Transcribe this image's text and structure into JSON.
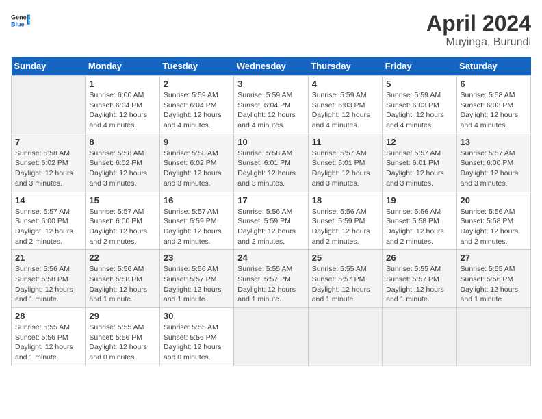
{
  "header": {
    "logo_general": "General",
    "logo_blue": "Blue",
    "title": "April 2024",
    "subtitle": "Muyinga, Burundi"
  },
  "calendar": {
    "days_of_week": [
      "Sunday",
      "Monday",
      "Tuesday",
      "Wednesday",
      "Thursday",
      "Friday",
      "Saturday"
    ],
    "weeks": [
      [
        {
          "day": "",
          "info": ""
        },
        {
          "day": "1",
          "info": "Sunrise: 6:00 AM\nSunset: 6:04 PM\nDaylight: 12 hours\nand 4 minutes."
        },
        {
          "day": "2",
          "info": "Sunrise: 5:59 AM\nSunset: 6:04 PM\nDaylight: 12 hours\nand 4 minutes."
        },
        {
          "day": "3",
          "info": "Sunrise: 5:59 AM\nSunset: 6:04 PM\nDaylight: 12 hours\nand 4 minutes."
        },
        {
          "day": "4",
          "info": "Sunrise: 5:59 AM\nSunset: 6:03 PM\nDaylight: 12 hours\nand 4 minutes."
        },
        {
          "day": "5",
          "info": "Sunrise: 5:59 AM\nSunset: 6:03 PM\nDaylight: 12 hours\nand 4 minutes."
        },
        {
          "day": "6",
          "info": "Sunrise: 5:58 AM\nSunset: 6:03 PM\nDaylight: 12 hours\nand 4 minutes."
        }
      ],
      [
        {
          "day": "7",
          "info": "Sunrise: 5:58 AM\nSunset: 6:02 PM\nDaylight: 12 hours\nand 3 minutes."
        },
        {
          "day": "8",
          "info": "Sunrise: 5:58 AM\nSunset: 6:02 PM\nDaylight: 12 hours\nand 3 minutes."
        },
        {
          "day": "9",
          "info": "Sunrise: 5:58 AM\nSunset: 6:02 PM\nDaylight: 12 hours\nand 3 minutes."
        },
        {
          "day": "10",
          "info": "Sunrise: 5:58 AM\nSunset: 6:01 PM\nDaylight: 12 hours\nand 3 minutes."
        },
        {
          "day": "11",
          "info": "Sunrise: 5:57 AM\nSunset: 6:01 PM\nDaylight: 12 hours\nand 3 minutes."
        },
        {
          "day": "12",
          "info": "Sunrise: 5:57 AM\nSunset: 6:01 PM\nDaylight: 12 hours\nand 3 minutes."
        },
        {
          "day": "13",
          "info": "Sunrise: 5:57 AM\nSunset: 6:00 PM\nDaylight: 12 hours\nand 3 minutes."
        }
      ],
      [
        {
          "day": "14",
          "info": "Sunrise: 5:57 AM\nSunset: 6:00 PM\nDaylight: 12 hours\nand 2 minutes."
        },
        {
          "day": "15",
          "info": "Sunrise: 5:57 AM\nSunset: 6:00 PM\nDaylight: 12 hours\nand 2 minutes."
        },
        {
          "day": "16",
          "info": "Sunrise: 5:57 AM\nSunset: 5:59 PM\nDaylight: 12 hours\nand 2 minutes."
        },
        {
          "day": "17",
          "info": "Sunrise: 5:56 AM\nSunset: 5:59 PM\nDaylight: 12 hours\nand 2 minutes."
        },
        {
          "day": "18",
          "info": "Sunrise: 5:56 AM\nSunset: 5:59 PM\nDaylight: 12 hours\nand 2 minutes."
        },
        {
          "day": "19",
          "info": "Sunrise: 5:56 AM\nSunset: 5:58 PM\nDaylight: 12 hours\nand 2 minutes."
        },
        {
          "day": "20",
          "info": "Sunrise: 5:56 AM\nSunset: 5:58 PM\nDaylight: 12 hours\nand 2 minutes."
        }
      ],
      [
        {
          "day": "21",
          "info": "Sunrise: 5:56 AM\nSunset: 5:58 PM\nDaylight: 12 hours\nand 1 minute."
        },
        {
          "day": "22",
          "info": "Sunrise: 5:56 AM\nSunset: 5:58 PM\nDaylight: 12 hours\nand 1 minute."
        },
        {
          "day": "23",
          "info": "Sunrise: 5:56 AM\nSunset: 5:57 PM\nDaylight: 12 hours\nand 1 minute."
        },
        {
          "day": "24",
          "info": "Sunrise: 5:55 AM\nSunset: 5:57 PM\nDaylight: 12 hours\nand 1 minute."
        },
        {
          "day": "25",
          "info": "Sunrise: 5:55 AM\nSunset: 5:57 PM\nDaylight: 12 hours\nand 1 minute."
        },
        {
          "day": "26",
          "info": "Sunrise: 5:55 AM\nSunset: 5:57 PM\nDaylight: 12 hours\nand 1 minute."
        },
        {
          "day": "27",
          "info": "Sunrise: 5:55 AM\nSunset: 5:56 PM\nDaylight: 12 hours\nand 1 minute."
        }
      ],
      [
        {
          "day": "28",
          "info": "Sunrise: 5:55 AM\nSunset: 5:56 PM\nDaylight: 12 hours\nand 1 minute."
        },
        {
          "day": "29",
          "info": "Sunrise: 5:55 AM\nSunset: 5:56 PM\nDaylight: 12 hours\nand 0 minutes."
        },
        {
          "day": "30",
          "info": "Sunrise: 5:55 AM\nSunset: 5:56 PM\nDaylight: 12 hours\nand 0 minutes."
        },
        {
          "day": "",
          "info": ""
        },
        {
          "day": "",
          "info": ""
        },
        {
          "day": "",
          "info": ""
        },
        {
          "day": "",
          "info": ""
        }
      ]
    ]
  }
}
